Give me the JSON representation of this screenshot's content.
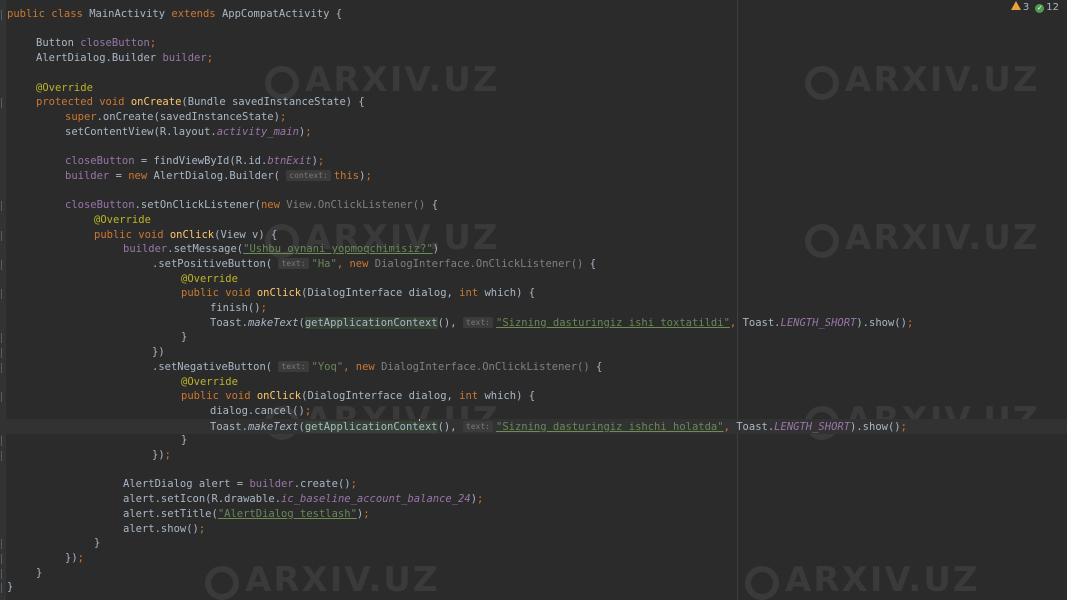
{
  "editor": {
    "status": {
      "warnings": "3",
      "checks": "12"
    },
    "watermark": "ARXIV.UZ",
    "lines": [
      {
        "indent": 0,
        "segs": [
          [
            "kw",
            "public class "
          ],
          [
            "",
            "MainActivity "
          ],
          [
            "kw",
            "extends "
          ],
          [
            "",
            "AppCompatActivity {"
          ]
        ]
      },
      {
        "indent": 0,
        "segs": []
      },
      {
        "indent": 1,
        "segs": [
          [
            "",
            "Button "
          ],
          [
            "field",
            "closeButton"
          ],
          [
            "kw",
            ";"
          ]
        ]
      },
      {
        "indent": 1,
        "segs": [
          [
            "",
            "AlertDialog.Builder "
          ],
          [
            "field",
            "builder"
          ],
          [
            "kw",
            ";"
          ]
        ]
      },
      {
        "indent": 0,
        "segs": []
      },
      {
        "indent": 1,
        "segs": [
          [
            "ann",
            "@Override"
          ]
        ]
      },
      {
        "indent": 1,
        "segs": [
          [
            "kw",
            "protected void "
          ],
          [
            "fn",
            "onCreate"
          ],
          [
            "",
            "(Bundle savedInstanceState) {"
          ]
        ]
      },
      {
        "indent": 2,
        "segs": [
          [
            "kw",
            "super"
          ],
          [
            "",
            ".onCreate(savedInstanceState)"
          ],
          [
            "kw",
            ";"
          ]
        ]
      },
      {
        "indent": 2,
        "segs": [
          [
            "",
            "setContentView(R.layout."
          ],
          [
            "ital",
            "activity_main"
          ],
          [
            "",
            ")"
          ],
          [
            "kw",
            ";"
          ]
        ]
      },
      {
        "indent": 0,
        "segs": []
      },
      {
        "indent": 2,
        "segs": [
          [
            "field",
            "closeButton"
          ],
          [
            "",
            " = findViewById(R.id."
          ],
          [
            "ital",
            "btnExit"
          ],
          [
            "",
            ")"
          ],
          [
            "kw",
            ";"
          ]
        ]
      },
      {
        "indent": 2,
        "segs": [
          [
            "field",
            "builder"
          ],
          [
            "",
            " = "
          ],
          [
            "kw",
            "new "
          ],
          [
            "",
            "AlertDialog.Builder( "
          ],
          [
            "hint",
            "context:"
          ],
          [
            "kw",
            "this"
          ],
          [
            "",
            ")"
          ],
          [
            "kw",
            ";"
          ]
        ]
      },
      {
        "indent": 0,
        "segs": []
      },
      {
        "indent": 2,
        "segs": [
          [
            "field",
            "closeButton"
          ],
          [
            "",
            ".setOnClickListener("
          ],
          [
            "kw",
            "new "
          ],
          [
            "gray",
            "View.OnClickListener() "
          ],
          [
            "",
            "{"
          ]
        ]
      },
      {
        "indent": 3,
        "segs": [
          [
            "ann",
            "@Override"
          ]
        ]
      },
      {
        "indent": 3,
        "segs": [
          [
            "kw",
            "public void "
          ],
          [
            "fn",
            "onClick"
          ],
          [
            "",
            "(View v) {"
          ]
        ]
      },
      {
        "indent": 4,
        "segs": [
          [
            "field",
            "builder"
          ],
          [
            "",
            ".setMessage("
          ],
          [
            "str",
            "\"Ushbu oynani yopmoqchimisiz?\""
          ],
          [
            "",
            ")"
          ]
        ]
      },
      {
        "indent": 5,
        "segs": [
          [
            "",
            ".setPositiveButton( "
          ],
          [
            "hint",
            "text:"
          ],
          [
            "str",
            "\"Ha\""
          ],
          [
            "kw",
            ", new "
          ],
          [
            "gray",
            "DialogInterface.OnClickListener() "
          ],
          [
            "",
            "{"
          ]
        ]
      },
      {
        "indent": 6,
        "segs": [
          [
            "ann",
            "@Override"
          ]
        ]
      },
      {
        "indent": 6,
        "segs": [
          [
            "kw",
            "public void "
          ],
          [
            "fn",
            "onClick"
          ],
          [
            "",
            "(DialogInterface dialog, "
          ],
          [
            "kw",
            "int "
          ],
          [
            "",
            "which) {"
          ]
        ]
      },
      {
        "indent": 7,
        "segs": [
          [
            "",
            "finish()"
          ],
          [
            "kw",
            ";"
          ]
        ]
      },
      {
        "indent": 7,
        "segs": [
          [
            "",
            "Toast."
          ],
          [
            "static",
            "makeText"
          ],
          [
            "",
            "("
          ],
          [
            "hl",
            "getApplicationContext"
          ],
          [
            "",
            "(), "
          ],
          [
            "hint",
            "text:"
          ],
          [
            "str",
            "\"Sizning dasturingiz ishi toxtatildi\""
          ],
          [
            "kw",
            ", "
          ],
          [
            "",
            "Toast."
          ],
          [
            "ital",
            "LENGTH_SHORT"
          ],
          [
            "",
            ").show()"
          ],
          [
            "kw",
            ";"
          ]
        ]
      },
      {
        "indent": 6,
        "segs": [
          [
            "",
            "}"
          ]
        ]
      },
      {
        "indent": 5,
        "segs": [
          [
            "",
            "})"
          ]
        ]
      },
      {
        "indent": 5,
        "segs": [
          [
            "",
            ".setNegativeButton( "
          ],
          [
            "hint",
            "text:"
          ],
          [
            "str",
            "\"Yoq\""
          ],
          [
            "kw",
            ", new "
          ],
          [
            "gray",
            "DialogInterface.OnClickListener() "
          ],
          [
            "",
            "{"
          ]
        ]
      },
      {
        "indent": 6,
        "segs": [
          [
            "ann",
            "@Override"
          ]
        ]
      },
      {
        "indent": 6,
        "segs": [
          [
            "kw",
            "public void "
          ],
          [
            "fn",
            "onClick"
          ],
          [
            "",
            "(DialogInterface dialog, "
          ],
          [
            "kw",
            "int "
          ],
          [
            "",
            "which) {"
          ]
        ]
      },
      {
        "indent": 7,
        "segs": [
          [
            "",
            "dialog.cancel()"
          ],
          [
            "kw",
            ";"
          ]
        ]
      },
      {
        "indent": 7,
        "current": true,
        "segs": [
          [
            "",
            "Toast."
          ],
          [
            "static",
            "makeText"
          ],
          [
            "",
            "("
          ],
          [
            "hl",
            "getApplicationCont"
          ],
          [
            "caret",
            ""
          ],
          [
            "hl",
            "ext"
          ],
          [
            "",
            "(), "
          ],
          [
            "hint",
            "text:"
          ],
          [
            "str",
            "\"Sizning dasturingiz ishchi holatda\""
          ],
          [
            "kw",
            ", "
          ],
          [
            "",
            "Toast."
          ],
          [
            "ital",
            "LENGTH_SHORT"
          ],
          [
            "",
            ").show()"
          ],
          [
            "kw",
            ";"
          ]
        ]
      },
      {
        "indent": 6,
        "segs": [
          [
            "",
            "}"
          ]
        ]
      },
      {
        "indent": 5,
        "segs": [
          [
            "",
            "})"
          ],
          [
            "kw",
            ";"
          ]
        ]
      },
      {
        "indent": 0,
        "segs": []
      },
      {
        "indent": 4,
        "segs": [
          [
            "",
            "AlertDialog alert = "
          ],
          [
            "field",
            "builder"
          ],
          [
            "",
            ".create()"
          ],
          [
            "kw",
            ";"
          ]
        ]
      },
      {
        "indent": 4,
        "segs": [
          [
            "",
            "alert.setIcon(R.drawable."
          ],
          [
            "ital",
            "ic_baseline_account_balance_24"
          ],
          [
            "",
            ")"
          ],
          [
            "kw",
            ";"
          ]
        ]
      },
      {
        "indent": 4,
        "segs": [
          [
            "",
            "alert.setTitle("
          ],
          [
            "str",
            "\"AlertDialog testlash\""
          ],
          [
            "",
            ")"
          ],
          [
            "kw",
            ";"
          ]
        ]
      },
      {
        "indent": 4,
        "segs": [
          [
            "",
            "alert.show()"
          ],
          [
            "kw",
            ";"
          ]
        ]
      },
      {
        "indent": 3,
        "segs": [
          [
            "",
            "}"
          ]
        ]
      },
      {
        "indent": 2,
        "segs": [
          [
            "",
            "})"
          ],
          [
            "kw",
            ";"
          ]
        ]
      },
      {
        "indent": 1,
        "segs": [
          [
            "",
            "}"
          ]
        ]
      },
      {
        "indent": 0,
        "segs": [
          [
            "",
            "}"
          ]
        ]
      }
    ]
  }
}
